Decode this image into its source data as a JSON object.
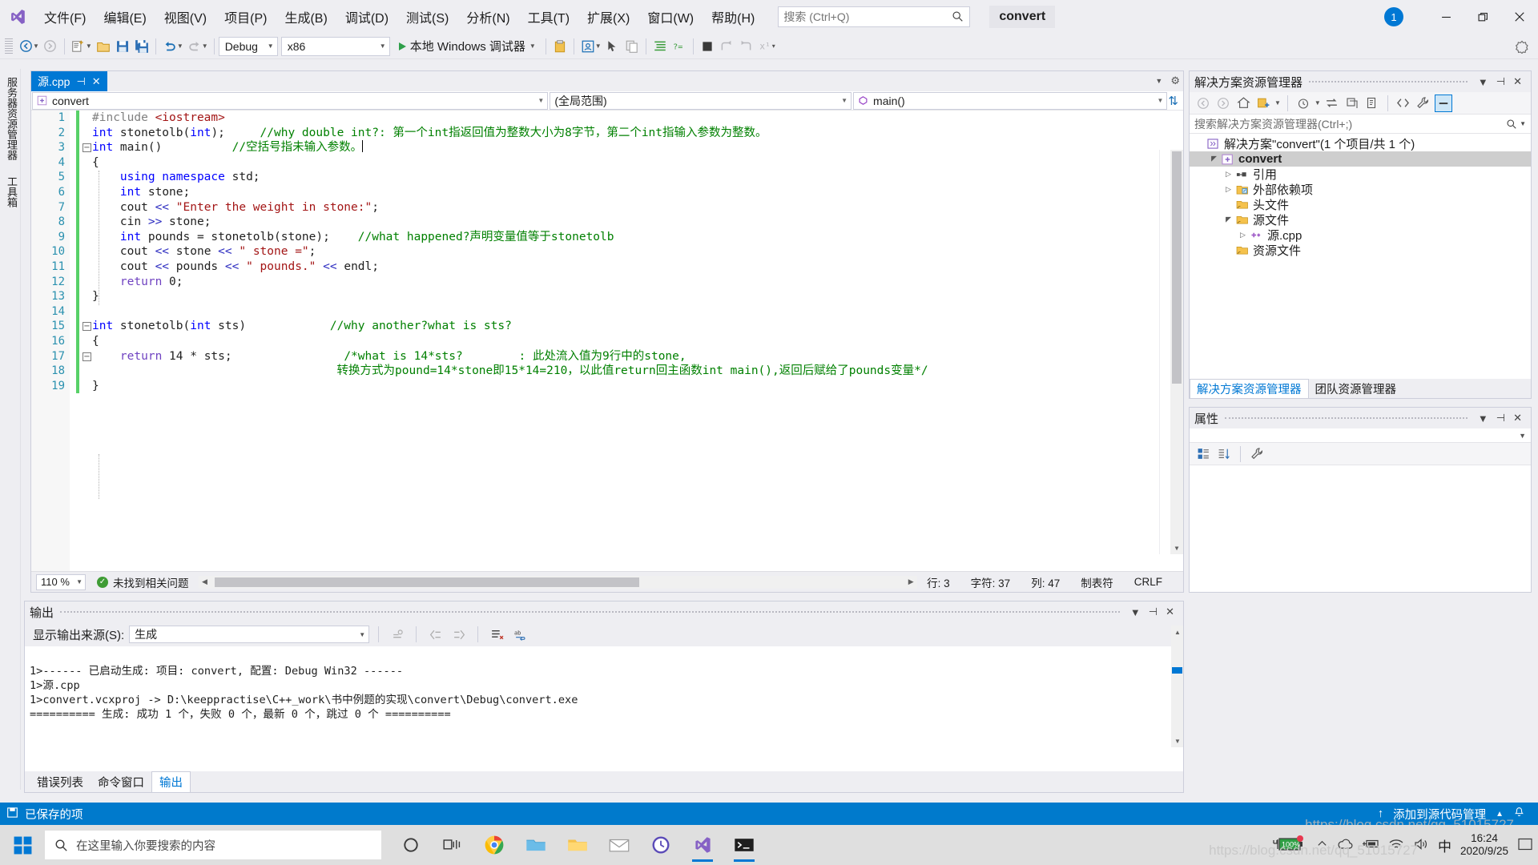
{
  "window": {
    "title": "convert",
    "notification_count": "1",
    "minimize": "—",
    "maximize": "❐",
    "close": "✕"
  },
  "menu": {
    "items": [
      {
        "label": "文件(F)",
        "name": "menu-file"
      },
      {
        "label": "编辑(E)",
        "name": "menu-edit"
      },
      {
        "label": "视图(V)",
        "name": "menu-view"
      },
      {
        "label": "项目(P)",
        "name": "menu-project"
      },
      {
        "label": "生成(B)",
        "name": "menu-build"
      },
      {
        "label": "调试(D)",
        "name": "menu-debug"
      },
      {
        "label": "测试(S)",
        "name": "menu-test"
      },
      {
        "label": "分析(N)",
        "name": "menu-analyze"
      },
      {
        "label": "工具(T)",
        "name": "menu-tools"
      },
      {
        "label": "扩展(X)",
        "name": "menu-extensions"
      },
      {
        "label": "窗口(W)",
        "name": "menu-window"
      },
      {
        "label": "帮助(H)",
        "name": "menu-help"
      }
    ]
  },
  "search": {
    "placeholder": "搜索 (Ctrl+Q)",
    "value": ""
  },
  "toolbar": {
    "config": "Debug",
    "platform": "x86",
    "run_label": "本地 Windows 调试器"
  },
  "left_rail": {
    "items": [
      {
        "label": "服务器资源管理器",
        "name": "rail-server-explorer"
      },
      {
        "label": "工具箱",
        "name": "rail-toolbox"
      }
    ]
  },
  "editor": {
    "tab": {
      "title": "源.cpp",
      "pin": "⊣",
      "close": "✕"
    },
    "nav": {
      "project": "convert",
      "scope": "(全局范围)",
      "member": "main()"
    },
    "lines": [
      {
        "n": "1",
        "glyph": "",
        "change": true,
        "tokens": [
          {
            "t": "#include ",
            "c": "pp"
          },
          {
            "t": "<iostream>",
            "c": "st"
          }
        ]
      },
      {
        "n": "2",
        "glyph": "",
        "change": true,
        "tokens": [
          {
            "t": "int",
            "c": "k"
          },
          {
            "t": " stonetolb(",
            "c": "id"
          },
          {
            "t": "int",
            "c": "k"
          },
          {
            "t": ");     ",
            "c": "id"
          },
          {
            "t": "//why double int?: 第一个int指返回值为整数大小为8字节，第二个int指输入参数为整数。",
            "c": "cm"
          }
        ]
      },
      {
        "n": "3",
        "glyph": "−",
        "change": true,
        "cursor": true,
        "tokens": [
          {
            "t": "int",
            "c": "k"
          },
          {
            "t": " main()          ",
            "c": "id"
          },
          {
            "t": "//空括号指未输入参数。",
            "c": "cm"
          }
        ]
      },
      {
        "n": "4",
        "glyph": "",
        "change": true,
        "tokens": [
          {
            "t": "{",
            "c": "id"
          }
        ]
      },
      {
        "n": "5",
        "glyph": "",
        "change": true,
        "tokens": [
          {
            "t": "    ",
            "c": "id"
          },
          {
            "t": "using namespace",
            "c": "k"
          },
          {
            "t": " std;",
            "c": "id"
          }
        ]
      },
      {
        "n": "6",
        "glyph": "",
        "change": true,
        "tokens": [
          {
            "t": "    ",
            "c": "id"
          },
          {
            "t": "int",
            "c": "k"
          },
          {
            "t": " stone;",
            "c": "id"
          }
        ]
      },
      {
        "n": "7",
        "glyph": "",
        "change": true,
        "tokens": [
          {
            "t": "    cout ",
            "c": "id"
          },
          {
            "t": "<<",
            "c": "kk"
          },
          {
            "t": " ",
            "c": "id"
          },
          {
            "t": "\"Enter the weight in stone:\"",
            "c": "st"
          },
          {
            "t": ";",
            "c": "id"
          }
        ]
      },
      {
        "n": "8",
        "glyph": "",
        "change": true,
        "tokens": [
          {
            "t": "    cin ",
            "c": "id"
          },
          {
            "t": ">>",
            "c": "kk"
          },
          {
            "t": " stone;",
            "c": "id"
          }
        ]
      },
      {
        "n": "9",
        "glyph": "",
        "change": true,
        "tokens": [
          {
            "t": "    ",
            "c": "id"
          },
          {
            "t": "int",
            "c": "k"
          },
          {
            "t": " pounds = stonetolb(stone);    ",
            "c": "id"
          },
          {
            "t": "//what happened?声明变量值等于stonetolb",
            "c": "cm"
          }
        ]
      },
      {
        "n": "10",
        "glyph": "",
        "change": true,
        "tokens": [
          {
            "t": "    cout ",
            "c": "id"
          },
          {
            "t": "<<",
            "c": "kk"
          },
          {
            "t": " stone ",
            "c": "id"
          },
          {
            "t": "<<",
            "c": "kk"
          },
          {
            "t": " ",
            "c": "id"
          },
          {
            "t": "\" stone =\"",
            "c": "st"
          },
          {
            "t": ";",
            "c": "id"
          }
        ]
      },
      {
        "n": "11",
        "glyph": "",
        "change": true,
        "tokens": [
          {
            "t": "    cout ",
            "c": "id"
          },
          {
            "t": "<<",
            "c": "kk"
          },
          {
            "t": " pounds ",
            "c": "id"
          },
          {
            "t": "<<",
            "c": "kk"
          },
          {
            "t": " ",
            "c": "id"
          },
          {
            "t": "\" pounds.\"",
            "c": "st"
          },
          {
            "t": " ",
            "c": "id"
          },
          {
            "t": "<<",
            "c": "kk"
          },
          {
            "t": " endl;",
            "c": "id"
          }
        ]
      },
      {
        "n": "12",
        "glyph": "",
        "change": true,
        "tokens": [
          {
            "t": "    ",
            "c": "id"
          },
          {
            "t": "return",
            "c": "op"
          },
          {
            "t": " ",
            "c": "id"
          },
          {
            "t": "0",
            "c": "num"
          },
          {
            "t": ";",
            "c": "id"
          }
        ]
      },
      {
        "n": "13",
        "glyph": "",
        "change": true,
        "tokens": [
          {
            "t": "}",
            "c": "id"
          }
        ]
      },
      {
        "n": "14",
        "glyph": "",
        "change": true,
        "tokens": []
      },
      {
        "n": "15",
        "glyph": "−",
        "change": true,
        "tokens": [
          {
            "t": "int",
            "c": "k"
          },
          {
            "t": " stonetolb(",
            "c": "id"
          },
          {
            "t": "int",
            "c": "k"
          },
          {
            "t": " sts)            ",
            "c": "id"
          },
          {
            "t": "//why another?what is sts?",
            "c": "cm"
          }
        ]
      },
      {
        "n": "16",
        "glyph": "",
        "change": true,
        "tokens": [
          {
            "t": "{",
            "c": "id"
          }
        ]
      },
      {
        "n": "17",
        "glyph": "−",
        "change": true,
        "tokens": [
          {
            "t": "    ",
            "c": "id"
          },
          {
            "t": "return",
            "c": "op"
          },
          {
            "t": " ",
            "c": "id"
          },
          {
            "t": "14",
            "c": "num"
          },
          {
            "t": " * sts;                ",
            "c": "id"
          },
          {
            "t": "/*what is 14*sts?        : 此处流入值为9行中的stone,",
            "c": "cm"
          }
        ]
      },
      {
        "n": "18",
        "glyph": "",
        "change": true,
        "tokens": [
          {
            "t": "                                   ",
            "c": "id"
          },
          {
            "t": "转换方式为pound=14*stone即15*14=210，以此值return回主函数int main(),返回后赋给了pounds变量*/",
            "c": "cm"
          }
        ]
      },
      {
        "n": "19",
        "glyph": "",
        "change": true,
        "tokens": [
          {
            "t": "}",
            "c": "id"
          }
        ]
      }
    ],
    "status": {
      "zoom": "110 %",
      "issues": "未找到相关问题",
      "row": "行: 3",
      "chars": "字符: 37",
      "col": "列: 47",
      "tabs": "制表符",
      "eol": "CRLF"
    }
  },
  "solution_explorer": {
    "title": "解决方案资源管理器",
    "search_placeholder": "搜索解决方案资源管理器(Ctrl+;)",
    "tree": [
      {
        "label": "解决方案\"convert\"(1 个项目/共 1 个)",
        "indent": 0,
        "twisty": "",
        "icon": "solution-icon",
        "selected": false
      },
      {
        "label": "convert",
        "indent": 1,
        "twisty": "▲",
        "icon": "project-icon",
        "selected": true
      },
      {
        "label": "引用",
        "indent": 2,
        "twisty": "▷",
        "icon": "references-icon",
        "selected": false
      },
      {
        "label": "外部依赖项",
        "indent": 2,
        "twisty": "▷",
        "icon": "external-icon",
        "selected": false
      },
      {
        "label": "头文件",
        "indent": 2,
        "twisty": "",
        "icon": "folder-icon",
        "selected": false
      },
      {
        "label": "源文件",
        "indent": 2,
        "twisty": "▲",
        "icon": "folder-icon",
        "selected": false
      },
      {
        "label": "源.cpp",
        "indent": 3,
        "twisty": "▷",
        "icon": "cpp-file-icon",
        "selected": false
      },
      {
        "label": "资源文件",
        "indent": 2,
        "twisty": "",
        "icon": "folder-icon",
        "selected": false
      }
    ],
    "tabs": [
      {
        "label": "解决方案资源管理器",
        "active": true
      },
      {
        "label": "团队资源管理器",
        "active": false
      }
    ]
  },
  "properties": {
    "title": "属性"
  },
  "output": {
    "title": "输出",
    "source_label": "显示输出来源(S):",
    "source_value": "生成",
    "lines": [
      "1>------ 已启动生成: 项目: convert, 配置: Debug Win32 ------",
      "1>源.cpp",
      "1>convert.vcxproj -> D:\\keeppractise\\C++_work\\书中例题的实现\\convert\\Debug\\convert.exe",
      "========== 生成: 成功 1 个，失败 0 个，最新 0 个，跳过 0 个 =========="
    ],
    "tabs": [
      {
        "label": "错误列表",
        "active": false
      },
      {
        "label": "命令窗口",
        "active": false
      },
      {
        "label": "输出",
        "active": true
      }
    ]
  },
  "vs_status": {
    "message": "已保存的项",
    "source_control": "添加到源代码管理",
    "arrow": "↑",
    "caret": "▲"
  },
  "taskbar": {
    "search_placeholder": "在这里输入你要搜索的内容",
    "battery": "100%",
    "ime": "中",
    "time": "16:24",
    "date": "2020/9/25"
  },
  "watermark": "https://blog.csdn.net/qq_51015727",
  "colors": {
    "accent": "#0078d4",
    "status_bar": "#007acc",
    "chrome": "#eeeef2",
    "change_bar": "#58d168",
    "comment": "#008000",
    "string": "#a31515",
    "keyword": "#0000ff"
  }
}
